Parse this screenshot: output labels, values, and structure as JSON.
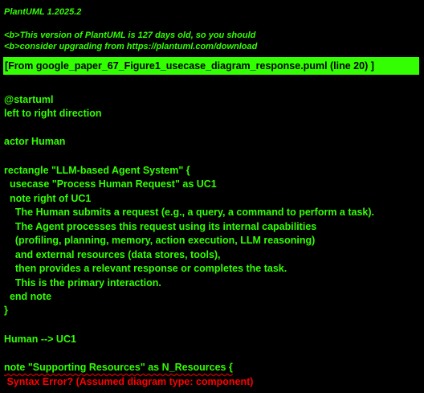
{
  "header": {
    "version": "PlantUML 1.2025.2",
    "notice_line1": "<b>This version of PlantUML is 127 days old, so you should",
    "notice_line2": "<b>consider upgrading from https://plantuml.com/download"
  },
  "source_banner": "[From google_paper_67_Figure1_usecase_diagram_response.puml (line 20) ]",
  "code_lines": [
    "@startuml",
    "left to right direction",
    "",
    "actor Human",
    "",
    "rectangle \"LLM-based Agent System\" {",
    "  usecase \"Process Human Request\" as UC1",
    "  note right of UC1",
    "    The Human submits a request (e.g., a query, a command to perform a task).",
    "    The Agent processes this request using its internal capabilities",
    "    (profiling, planning, memory, action execution, LLM reasoning)",
    "    and external resources (data stores, tools),",
    "    then provides a relevant response or completes the task.",
    "    This is the primary interaction.",
    "  end note",
    "}",
    "",
    "Human --> UC1",
    "",
    "note \"Supporting Resources\" as N_Resources {"
  ],
  "error_message": " Syntax Error? (Assumed diagram type: component)",
  "colors": {
    "background": "#000000",
    "text": "#33ff02",
    "error": "#ff0000"
  }
}
